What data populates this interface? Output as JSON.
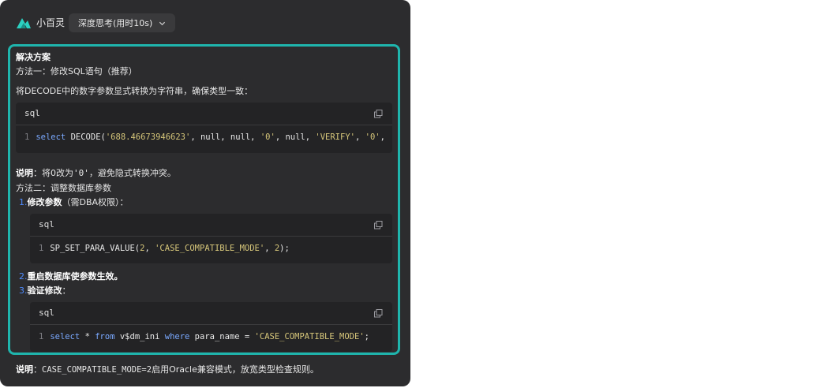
{
  "header": {
    "app_name": "小百灵",
    "think_label": "深度思考(用时10s)"
  },
  "solution": {
    "title": "解决方案",
    "method1": "方法一：修改SQL语句（推荐）",
    "method1_desc": "将DECODE中的数字参数显式转换为字符串，确保类型一致：",
    "code1": {
      "lang": "sql",
      "line_no": "1",
      "kw_select": "select",
      "fn": "DECODE(",
      "s1": "'688.46673946623'",
      "p1": ", null, null, ",
      "s2": "'0'",
      "p2": ", null, ",
      "s3": "'VERIFY'",
      "p3": ", ",
      "s4": "'0'",
      "p4": ","
    },
    "note1_label": "说明",
    "note1_a": "：将0改为",
    "note1_code": "'0'",
    "note1_b": "，避免隐式转换冲突。",
    "method2": "方法二：调整数据库参数",
    "step1_num": "1.",
    "step1_bold": "修改参数",
    "step1_rest": "（需DBA权限）：",
    "code2": {
      "lang": "sql",
      "line_no": "1",
      "fn": "SP_SET_PARA_VALUE(",
      "n1": "2",
      "p1": ", ",
      "s1": "'CASE_COMPATIBLE_MODE'",
      "p2": ", ",
      "n2": "2",
      "p3": ");"
    },
    "step2_num": "2.",
    "step2_bold": "重启数据库使参数生效。",
    "step3_num": "3.",
    "step3_bold": "验证修改",
    "step3_rest": "：",
    "code3": {
      "lang": "sql",
      "line_no": "1",
      "kw_select": "select",
      "star": " * ",
      "kw_from": "from",
      "tbl": " v$dm_ini ",
      "kw_where": "where",
      "cond": " para_name = ",
      "s1": "'CASE_COMPATIBLE_MODE'",
      "end": ";"
    }
  },
  "footer": {
    "label": "说明",
    "colon": "：",
    "code": "CASE_COMPATIBLE_MODE=2",
    "rest": "启用Oracle兼容模式，放宽类型检查规则。"
  },
  "icons": {
    "logo": "bird-logo-icon",
    "chevron": "chevron-down-icon",
    "copy": "copy-icon"
  },
  "colors": {
    "accent_border": "#1fb5ad",
    "panel_bg": "#2c2c2e",
    "keyword": "#7aa9ff",
    "string": "#d6c67a"
  }
}
